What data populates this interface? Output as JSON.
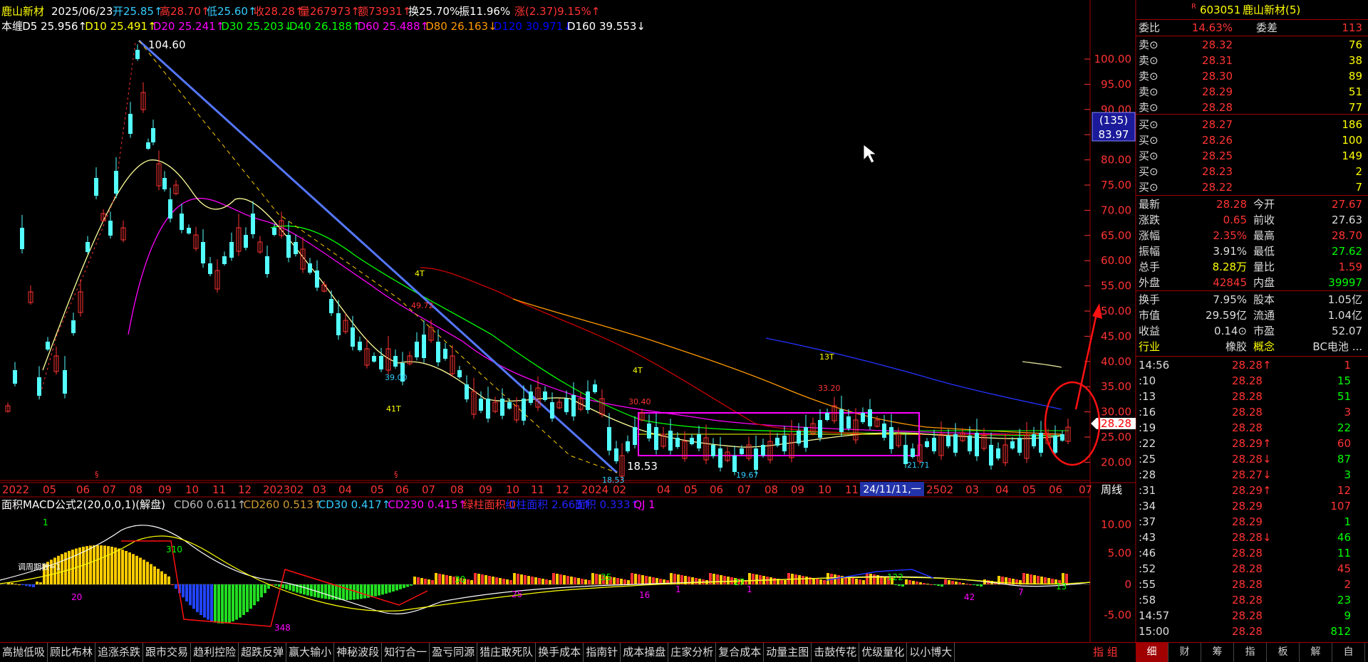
{
  "header": {
    "name": "鹿山新材",
    "date": "2025/06/23",
    "open": "开25.85↑",
    "high": "高28.70↑",
    "low": "低25.60↑",
    "close": "收28.28↑",
    "volume": "量267973↑",
    "amount": "额73931↑",
    "turnover": "换25.70%",
    "amplitude": "振11.96%",
    "change": "涨(2.37)9.15%↑"
  },
  "ma_line": [
    {
      "text": "本缠",
      "color": "#ffffff"
    },
    {
      "text": "D5 25.956↑",
      "color": "#ffffff"
    },
    {
      "text": "D10 25.491↑",
      "color": "#ffff00"
    },
    {
      "text": "D20 25.241↑",
      "color": "#ff00ff"
    },
    {
      "text": "D30 25.203↓",
      "color": "#00ff00"
    },
    {
      "text": "D40 26.188↑",
      "color": "#00ff00"
    },
    {
      "text": "D60 25.488↑",
      "color": "#ff00ff"
    },
    {
      "text": "D80 26.163↓",
      "color": "#ff9900"
    },
    {
      "text": "D120 30.971↓",
      "color": "#0000ff"
    },
    {
      "text": "D160 39.553↓",
      "color": "#ffffff"
    }
  ],
  "price_axis": [
    "100.00",
    "95.00",
    "90.00",
    "85.00",
    "80.00",
    "75.00",
    "70.00",
    "65.00",
    "60.00",
    "55.00",
    "50.00",
    "45.00",
    "40.00",
    "35.00",
    "30.00",
    "25.00",
    "20.00"
  ],
  "price_box": {
    "count": "(135)",
    "price": "83.97"
  },
  "current_price_tag": "28.28",
  "time_axis": [
    "2022",
    "05",
    "06",
    "07",
    "08",
    "09",
    "10",
    "11",
    "12",
    "202302",
    "03",
    "04",
    "05",
    "06",
    "07",
    "08",
    "09",
    "10",
    "11",
    "12",
    "2024",
    "02",
    "04",
    "05",
    "06",
    "07",
    "08",
    "09",
    "10",
    "11",
    "2502",
    "03",
    "04",
    "05",
    "06",
    "07"
  ],
  "time_cursor": "24/11/11,一",
  "period": "周线",
  "annotations": [
    "104.60",
    "4T",
    "49.72",
    "39.00",
    "41T",
    "4T",
    "30.40",
    "13T",
    "33.20",
    "18.53",
    "18.53",
    "19.67",
    "21.71"
  ],
  "macd": {
    "title": "面积MACD公式2(20,0,0,1)(解盘)",
    "items": [
      {
        "text": "CD60 0.611↑",
        "color": "#bbbbbb"
      },
      {
        "text": "CD260 0.513↑",
        "color": "#cc9933"
      },
      {
        "text": "CD30 0.417↑",
        "color": "#33ccff"
      },
      {
        "text": "CD230 0.415↑",
        "color": "#ff00ff"
      },
      {
        "text": "绿柱面积 0",
        "color": "#ff3333"
      },
      {
        "text": "红柱面积 2.663↑",
        "color": "#2222ff"
      },
      {
        "text": "面积 0.333↑",
        "color": "#2222ff"
      },
      {
        "text": "QJ 1",
        "color": "#ff00ff"
      }
    ],
    "axis": [
      "10.00",
      "5.00",
      "0",
      "-5.00"
    ],
    "labels": [
      "1",
      "310",
      "20",
      "348",
      "30",
      "25",
      "35",
      "16",
      "1",
      "27",
      "1",
      "122",
      "42",
      "7",
      "13"
    ],
    "note": "调周期数=1"
  },
  "stock": {
    "flag": "R",
    "code": "603051",
    "name": "鹿山新材(5)"
  },
  "commission": {
    "ratio_label": "委比",
    "ratio": "14.63%",
    "diff_label": "委差",
    "diff": "113"
  },
  "asks": [
    {
      "label": "卖⊙",
      "price": "28.32",
      "vol": "76"
    },
    {
      "label": "卖⊙",
      "price": "28.31",
      "vol": "38"
    },
    {
      "label": "卖⊙",
      "price": "28.30",
      "vol": "89"
    },
    {
      "label": "卖⊙",
      "price": "28.29",
      "vol": "51"
    },
    {
      "label": "卖⊙",
      "price": "28.28",
      "vol": "77"
    }
  ],
  "bids": [
    {
      "label": "买⊙",
      "price": "28.27",
      "vol": "186"
    },
    {
      "label": "买⊙",
      "price": "28.26",
      "vol": "100"
    },
    {
      "label": "买⊙",
      "price": "28.25",
      "vol": "149"
    },
    {
      "label": "买⊙",
      "price": "28.23",
      "vol": "2"
    },
    {
      "label": "买⊙",
      "price": "28.22",
      "vol": "7"
    }
  ],
  "quote": [
    {
      "l1": "最新",
      "v1": "28.28",
      "c1": "#ff3333",
      "l2": "今开",
      "v2": "27.67",
      "c2": "#ff3333"
    },
    {
      "l1": "涨跌",
      "v1": "0.65",
      "c1": "#ff3333",
      "l2": "前收",
      "v2": "27.63",
      "c2": "#dddddd"
    },
    {
      "l1": "涨幅",
      "v1": "2.35%",
      "c1": "#ff3333",
      "l2": "最高",
      "v2": "28.70",
      "c2": "#ff3333"
    },
    {
      "l1": "振幅",
      "v1": "3.91%",
      "c1": "#dddddd",
      "l2": "最低",
      "v2": "27.62",
      "c2": "#00ff00"
    },
    {
      "l1": "总手",
      "v1": "8.28万",
      "c1": "#ffff00",
      "l2": "量比",
      "v2": "1.59",
      "c2": "#ff3333"
    },
    {
      "l1": "外盘",
      "v1": "42845",
      "c1": "#ff3333",
      "l2": "内盘",
      "v2": "39997",
      "c2": "#00ff00"
    }
  ],
  "fund": [
    {
      "l1": "换手",
      "v1": "7.95%",
      "l2": "股本",
      "v2": "1.05亿"
    },
    {
      "l1": "市值",
      "v1": "29.59亿",
      "l2": "流通",
      "v2": "1.04亿"
    },
    {
      "l1": "收益",
      "v1": "0.14⊙",
      "l2": "市盈",
      "v2": "52.07"
    },
    {
      "l1": "行业",
      "v1": "橡胶",
      "l2": "概念",
      "v2": "BC电池 ..."
    }
  ],
  "ticks": [
    {
      "t": "14:56",
      "p": "28.28↑",
      "pc": "#ff3333",
      "v": "1",
      "vc": "#ff3333"
    },
    {
      "t": ":10",
      "p": "28.28",
      "pc": "#ff3333",
      "v": "15",
      "vc": "#00ff00"
    },
    {
      "t": ":13",
      "p": "28.28",
      "pc": "#ff3333",
      "v": "51",
      "vc": "#00ff00"
    },
    {
      "t": ":16",
      "p": "28.28",
      "pc": "#ff3333",
      "v": "3",
      "vc": "#ff3333"
    },
    {
      "t": ":19",
      "p": "28.28",
      "pc": "#ff3333",
      "v": "22",
      "vc": "#00ff00"
    },
    {
      "t": ":22",
      "p": "28.29↑",
      "pc": "#ff3333",
      "v": "60",
      "vc": "#ff3333"
    },
    {
      "t": ":25",
      "p": "28.28↓",
      "pc": "#ff3333",
      "v": "87",
      "vc": "#00ff00"
    },
    {
      "t": ":28",
      "p": "28.27↓",
      "pc": "#ff3333",
      "v": "3",
      "vc": "#00ff00"
    },
    {
      "t": ":31",
      "p": "28.29↑",
      "pc": "#ff3333",
      "v": "12",
      "vc": "#ff3333"
    },
    {
      "t": ":34",
      "p": "28.29",
      "pc": "#ff3333",
      "v": "107",
      "vc": "#ff3333"
    },
    {
      "t": ":37",
      "p": "28.29",
      "pc": "#ff3333",
      "v": "1",
      "vc": "#00ff00"
    },
    {
      "t": ":43",
      "p": "28.28↓",
      "pc": "#ff3333",
      "v": "46",
      "vc": "#00ff00"
    },
    {
      "t": ":46",
      "p": "28.28",
      "pc": "#ff3333",
      "v": "11",
      "vc": "#00ff00"
    },
    {
      "t": ":52",
      "p": "28.28",
      "pc": "#ff3333",
      "v": "45",
      "vc": "#ff3333"
    },
    {
      "t": ":55",
      "p": "28.28",
      "pc": "#ff3333",
      "v": "2",
      "vc": "#ff3333"
    },
    {
      "t": ":58",
      "p": "28.28",
      "pc": "#ff3333",
      "v": "23",
      "vc": "#00ff00"
    },
    {
      "t": "14:57",
      "p": "28.28",
      "pc": "#ff3333",
      "v": "9",
      "vc": "#00ff00"
    },
    {
      "t": "15:00",
      "p": "28.28",
      "pc": "#ff3333",
      "v": "812",
      "vc": "#00ff00"
    }
  ],
  "bottom_tabs": [
    "高抛低吸",
    "顾比布林",
    "追涨杀跌",
    "跟市交易",
    "趋利控险",
    "超跌反弹",
    "赢大输小",
    "神秘波段",
    "知行合一",
    "盈亏同源",
    "猎庄敢死队",
    "换手成本",
    "指南针",
    "成本操盘",
    "庄家分析",
    "复合成本",
    "动量主图",
    "击鼓传花",
    "优级量化",
    "以小博大"
  ],
  "bottom_right": [
    "指",
    "组"
  ],
  "right_tabs": [
    "细",
    "财",
    "筹",
    "指",
    "板",
    "解",
    "自"
  ],
  "colors": {
    "up": "#ff3333",
    "down": "#54ffff",
    "frame": "#a00000",
    "axis": "#ff3333"
  }
}
